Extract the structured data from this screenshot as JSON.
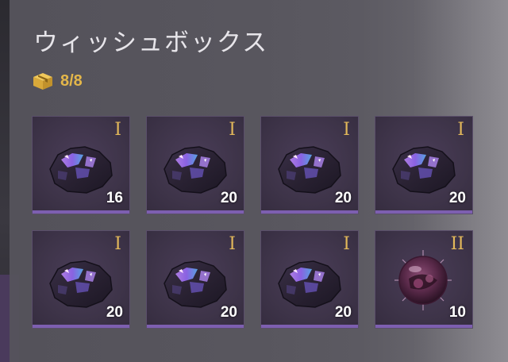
{
  "panel": {
    "title": "ウィッシュボックス",
    "capacity_icon": "box-icon",
    "capacity": "8/8"
  },
  "colors": {
    "tier": "#e2b85a",
    "capacity": "#e3b64a",
    "slot_bar": "#7d5fb0"
  },
  "slots": [
    {
      "item": "crystal-ore",
      "tier": "I",
      "quantity": "16"
    },
    {
      "item": "crystal-ore",
      "tier": "I",
      "quantity": "20"
    },
    {
      "item": "crystal-ore",
      "tier": "I",
      "quantity": "20"
    },
    {
      "item": "crystal-ore",
      "tier": "I",
      "quantity": "20"
    },
    {
      "item": "crystal-ore",
      "tier": "I",
      "quantity": "20"
    },
    {
      "item": "crystal-ore",
      "tier": "I",
      "quantity": "20"
    },
    {
      "item": "crystal-ore",
      "tier": "I",
      "quantity": "20"
    },
    {
      "item": "spiked-sphere",
      "tier": "II",
      "quantity": "10"
    }
  ]
}
